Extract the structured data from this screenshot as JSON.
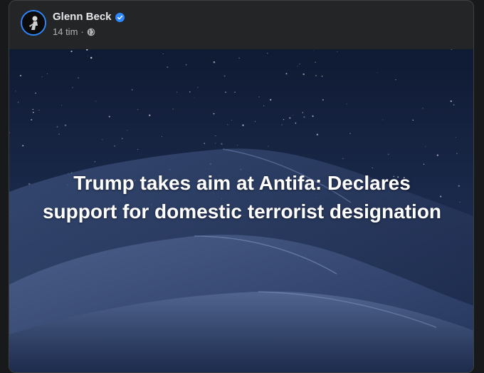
{
  "post": {
    "author": "Glenn Beck",
    "verified": true,
    "timestamp": "14 tim",
    "separator": "·",
    "audience_icon": "globe-icon",
    "headline": "Trump takes aim at Antifa: Declares support for domestic terrorist designation"
  },
  "colors": {
    "background": "#18191a",
    "card": "#242526",
    "verified_badge": "#2d88ff",
    "name_text": "#e4e6eb",
    "meta_text": "#b0b3b8",
    "sky_top": "#0f1a33",
    "dune": "#2a3d66"
  }
}
